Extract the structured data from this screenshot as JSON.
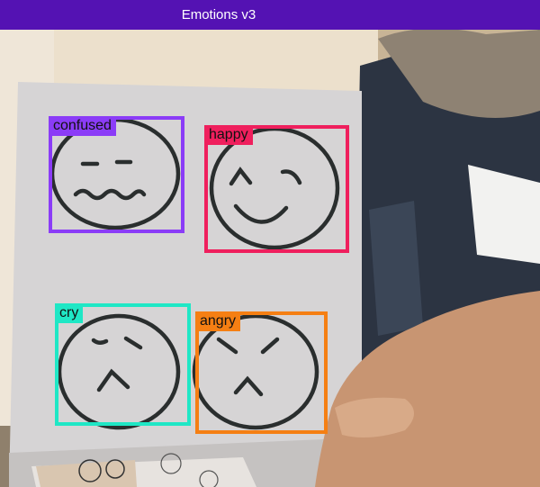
{
  "app": {
    "title": "Emotions v3",
    "bar_color": "#5412b3"
  },
  "detections": [
    {
      "label": "confused",
      "color": "#8b3cf7"
    },
    {
      "label": "happy",
      "color": "#ef1f5d"
    },
    {
      "label": "cry",
      "color": "#1fe7c5"
    },
    {
      "label": "angry",
      "color": "#f57f13"
    }
  ]
}
